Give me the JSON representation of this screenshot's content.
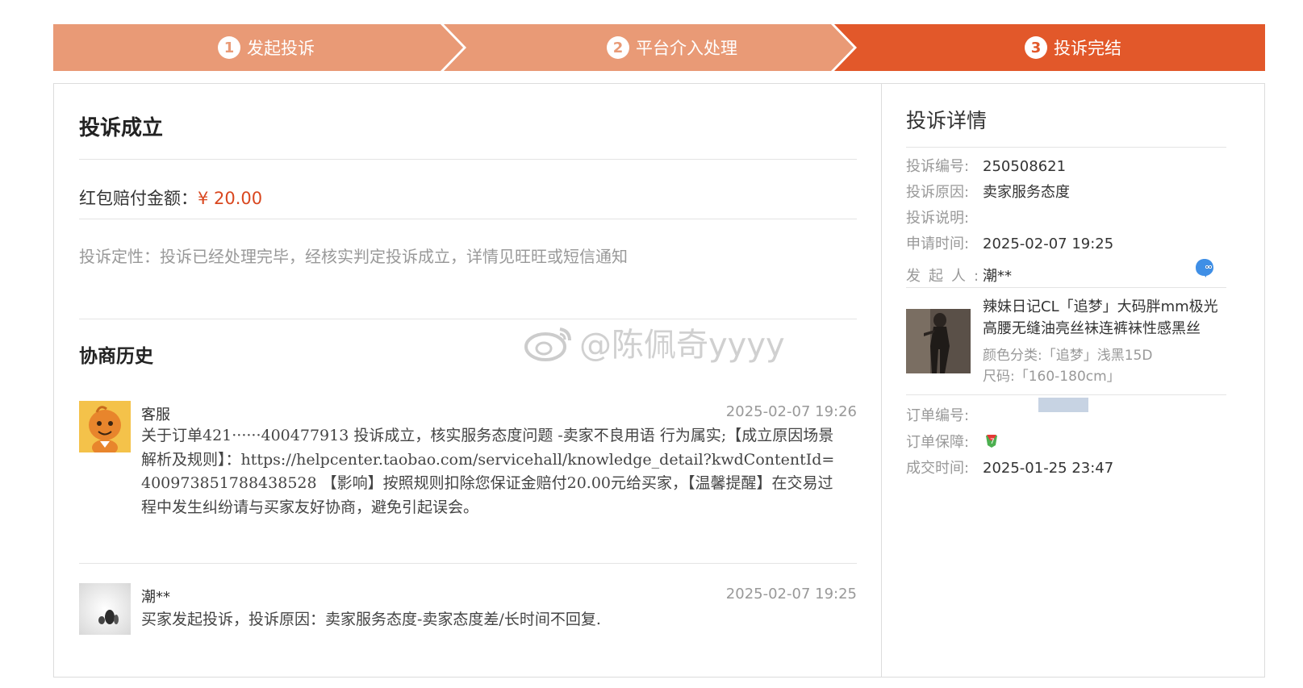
{
  "steps": [
    {
      "num": "1",
      "label": "发起投诉"
    },
    {
      "num": "2",
      "label": "平台介入处理"
    },
    {
      "num": "3",
      "label": "投诉完结"
    }
  ],
  "colors": {
    "step_inactive": "#e99a76",
    "step_active": "#e2582a",
    "price": "#d9471f"
  },
  "left": {
    "title": "投诉成立",
    "amount_label": "红包赔付金额：",
    "amount_value": "¥ 20.00",
    "nature": "投诉定性：投诉已经处理完毕，经核实判定投诉成立，详情见旺旺或短信通知",
    "history_title": "协商历史",
    "history": [
      {
        "name": "客服",
        "time": "2025-02-07 19:26",
        "text": "关于订单421······400477913 投诉成立，核实服务态度问题 -卖家不良用语 行为属实;【成立原因场景解析及规则】：https://helpcenter.taobao.com/servicehall/knowledge_detail?kwdContentId=400973851788438528 【影响】按照规则扣除您保证金赔付20.00元给买家，【温馨提醒】在交易过程中发生纠纷请与买家友好协商，避免引起误会。"
      },
      {
        "name": "潮**",
        "time": "2025-02-07 19:25",
        "text": "买家发起投诉，投诉原因：卖家服务态度-卖家态度差/长时间不回复."
      }
    ]
  },
  "right": {
    "title": "投诉详情",
    "complaint_no_label": "投诉编号:",
    "complaint_no": "250508621",
    "reason_label": "投诉原因:",
    "reason": "卖家服务态度",
    "desc_label": "投诉说明:",
    "desc": "",
    "apply_time_label": "申请时间:",
    "apply_time": "2025-02-07 19:25",
    "initiator_label": "发起人:",
    "initiator": "潮**",
    "product_title": "辣妹日记CL「追梦」大码胖mm极光高腰无缝油亮丝袜连裤袜性感黑丝",
    "product_color": "颜色分类:「追梦」浅黑15D",
    "product_size": "尺码:「160-180cm」",
    "order_no_label": "订单编号:",
    "order_no": "",
    "guarantee_label": "订单保障:",
    "deal_time_label": "成交时间:",
    "deal_time": "2025-01-25 23:47"
  },
  "watermark": "@陈佩奇yyyy",
  "icons": {
    "message": "wangwang-chat-icon",
    "guarantee": "order-guarantee-icon"
  }
}
